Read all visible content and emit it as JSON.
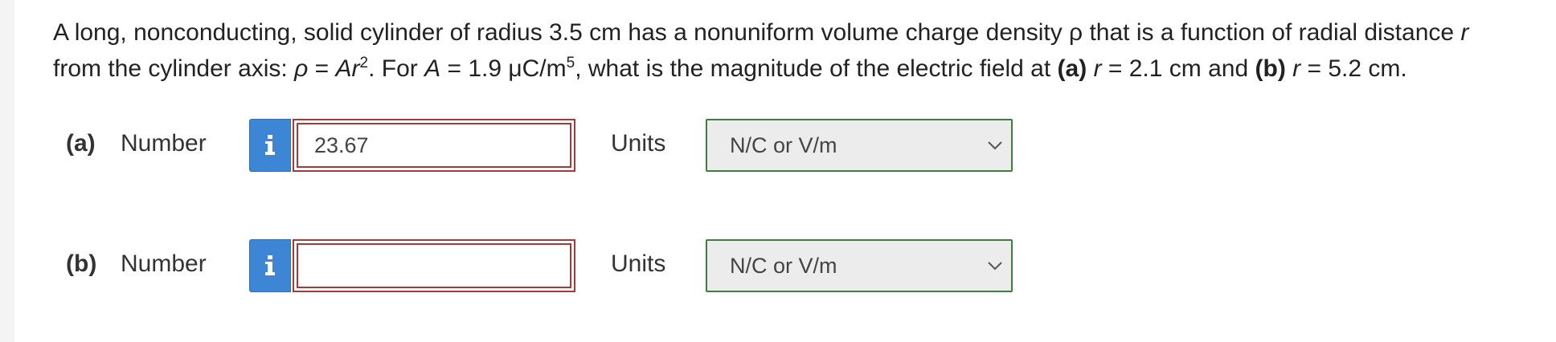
{
  "question": {
    "line1_text": "A long, nonconducting, solid cylinder of radius 3.5 cm has a nonuniform volume charge density ρ that is a function of radial distance ",
    "line1_var_r": "r",
    "line2_start": "from the cylinder axis: ",
    "rho_symbol": "ρ",
    "equals_1": " = ",
    "A_symbol": "A",
    "r_symbol": "r",
    "exp_2": "2",
    "text_for": ". For ",
    "A_symbol_2": "A",
    "text_A_value": " = 1.9 μC/m",
    "exp_5": "5",
    "text_what": ", what is the magnitude of the electric field at ",
    "part_a_marker": "(a)",
    "space_1": " ",
    "r_a": "r",
    "value_a": " = 2.1 cm and ",
    "part_b_marker": "(b)",
    "space_2": " ",
    "r_b": "r",
    "value_b": " = 5.2 cm."
  },
  "parts": [
    {
      "label": "(a)",
      "number_label": "Number",
      "value": "23.67",
      "units_label": "Units",
      "units_selected": "N/C or V/m"
    },
    {
      "label": "(b)",
      "number_label": "Number",
      "value": "",
      "units_label": "Units",
      "units_selected": "N/C or V/m"
    }
  ],
  "icons": {
    "info": "info-icon",
    "chevron": "chevron-down-icon"
  },
  "colors": {
    "info_button": "#3d86d6",
    "input_border": "#a33a3a",
    "select_border": "#3f7d3f",
    "select_background": "#ececec"
  }
}
